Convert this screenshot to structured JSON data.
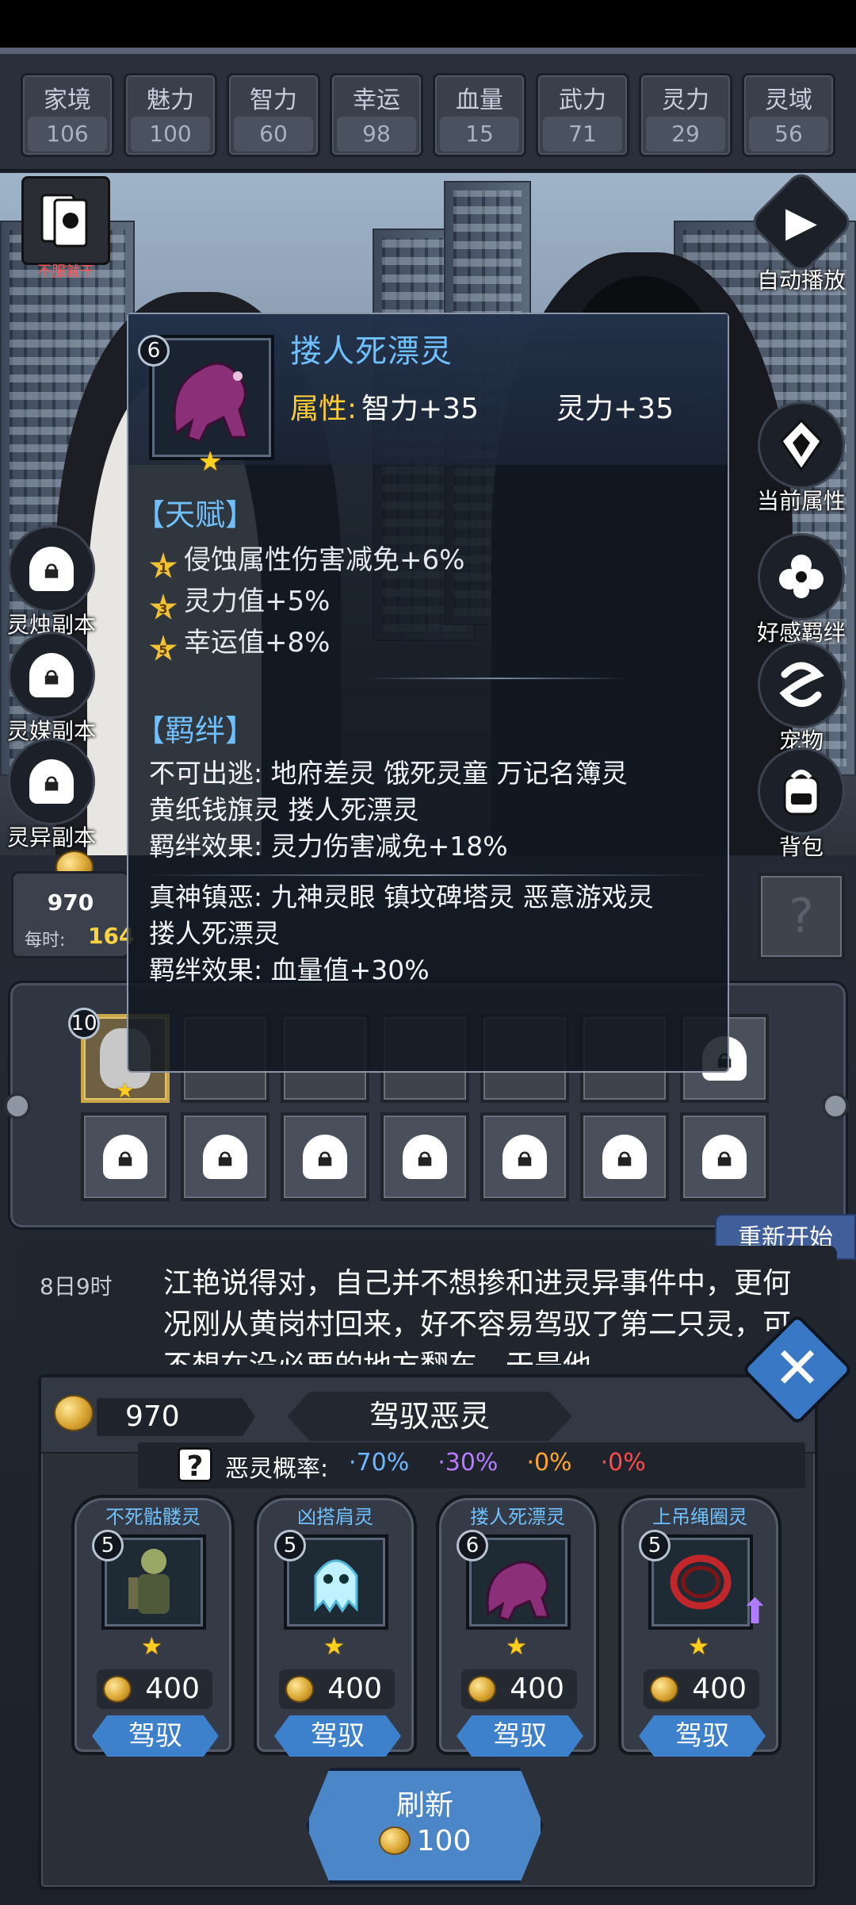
{
  "stats": [
    {
      "label": "家境",
      "value": "106"
    },
    {
      "label": "魅力",
      "value": "100"
    },
    {
      "label": "智力",
      "value": "60"
    },
    {
      "label": "幸运",
      "value": "98"
    },
    {
      "label": "血量",
      "value": "15"
    },
    {
      "label": "武力",
      "value": "71"
    },
    {
      "label": "灵力",
      "value": "29"
    },
    {
      "label": "灵域",
      "value": "56"
    }
  ],
  "left_menu": {
    "cards_badge": "不服就干",
    "dungeons": [
      "灵烛副本",
      "灵媒副本",
      "灵异副本"
    ]
  },
  "right_menu": [
    "自动播放",
    "当前属性",
    "好感羁绊",
    "宠物",
    "背包"
  ],
  "wallet": {
    "coins": "970",
    "per_hour_label": "每时:",
    "per_hour": "164"
  },
  "tooltip": {
    "level": "6",
    "name": "搂人死漂灵",
    "attr_label": "属性:",
    "attr1": "智力+35",
    "attr2": "灵力+35",
    "talent_title": "【天赋】",
    "talents": [
      {
        "rank": "1",
        "text": "侵蚀属性伤害减免+6%"
      },
      {
        "rank": "3",
        "text": "灵力值+5%"
      },
      {
        "rank": "5",
        "text": "幸运值+8%"
      }
    ],
    "bond_title": "【羁绊】",
    "bonds": [
      {
        "line1": "不可出逃: 地府差灵 饿死灵童 万记名簿灵",
        "line2": "黄纸钱旗灵 搂人死漂灵",
        "effect": "羁绊效果: 灵力伤害减免+18%"
      },
      {
        "line1": "真神镇恶: 九神灵眼 镇坟碑塔灵 恶意游戏灵",
        "line2": "搂人死漂灵",
        "effect": "羁绊效果: 血量值+30%"
      }
    ]
  },
  "slots": {
    "first_level": "10"
  },
  "restart_label": "重新开始",
  "story": {
    "time": "8日9时",
    "text": "江艳说得对，自己并不想掺和进灵异事件中，更何况刚从黄岗村回来，好不容易驾驭了第二只灵，可不想在没必要的地方翻车。于是他"
  },
  "modal": {
    "coins": "970",
    "title": "驾驭恶灵",
    "prob_label": "恶灵概率:",
    "probs": [
      {
        "text": "·70%",
        "color": "#6fb8ff"
      },
      {
        "text": "·30%",
        "color": "#b57cff"
      },
      {
        "text": "·0%",
        "color": "#ffa62b"
      },
      {
        "text": "·0%",
        "color": "#ff4b4b"
      }
    ],
    "cards": [
      {
        "name": "不死骷髅灵",
        "level": "5",
        "price": "400",
        "button": "驾驭"
      },
      {
        "name": "凶搭肩灵",
        "level": "5",
        "price": "400",
        "button": "驾驭"
      },
      {
        "name": "搂人死漂灵",
        "level": "6",
        "price": "400",
        "button": "驾驭"
      },
      {
        "name": "上吊绳圈灵",
        "level": "5",
        "price": "400",
        "button": "驾驭"
      }
    ],
    "refresh_label": "刷新",
    "refresh_cost": "100"
  }
}
